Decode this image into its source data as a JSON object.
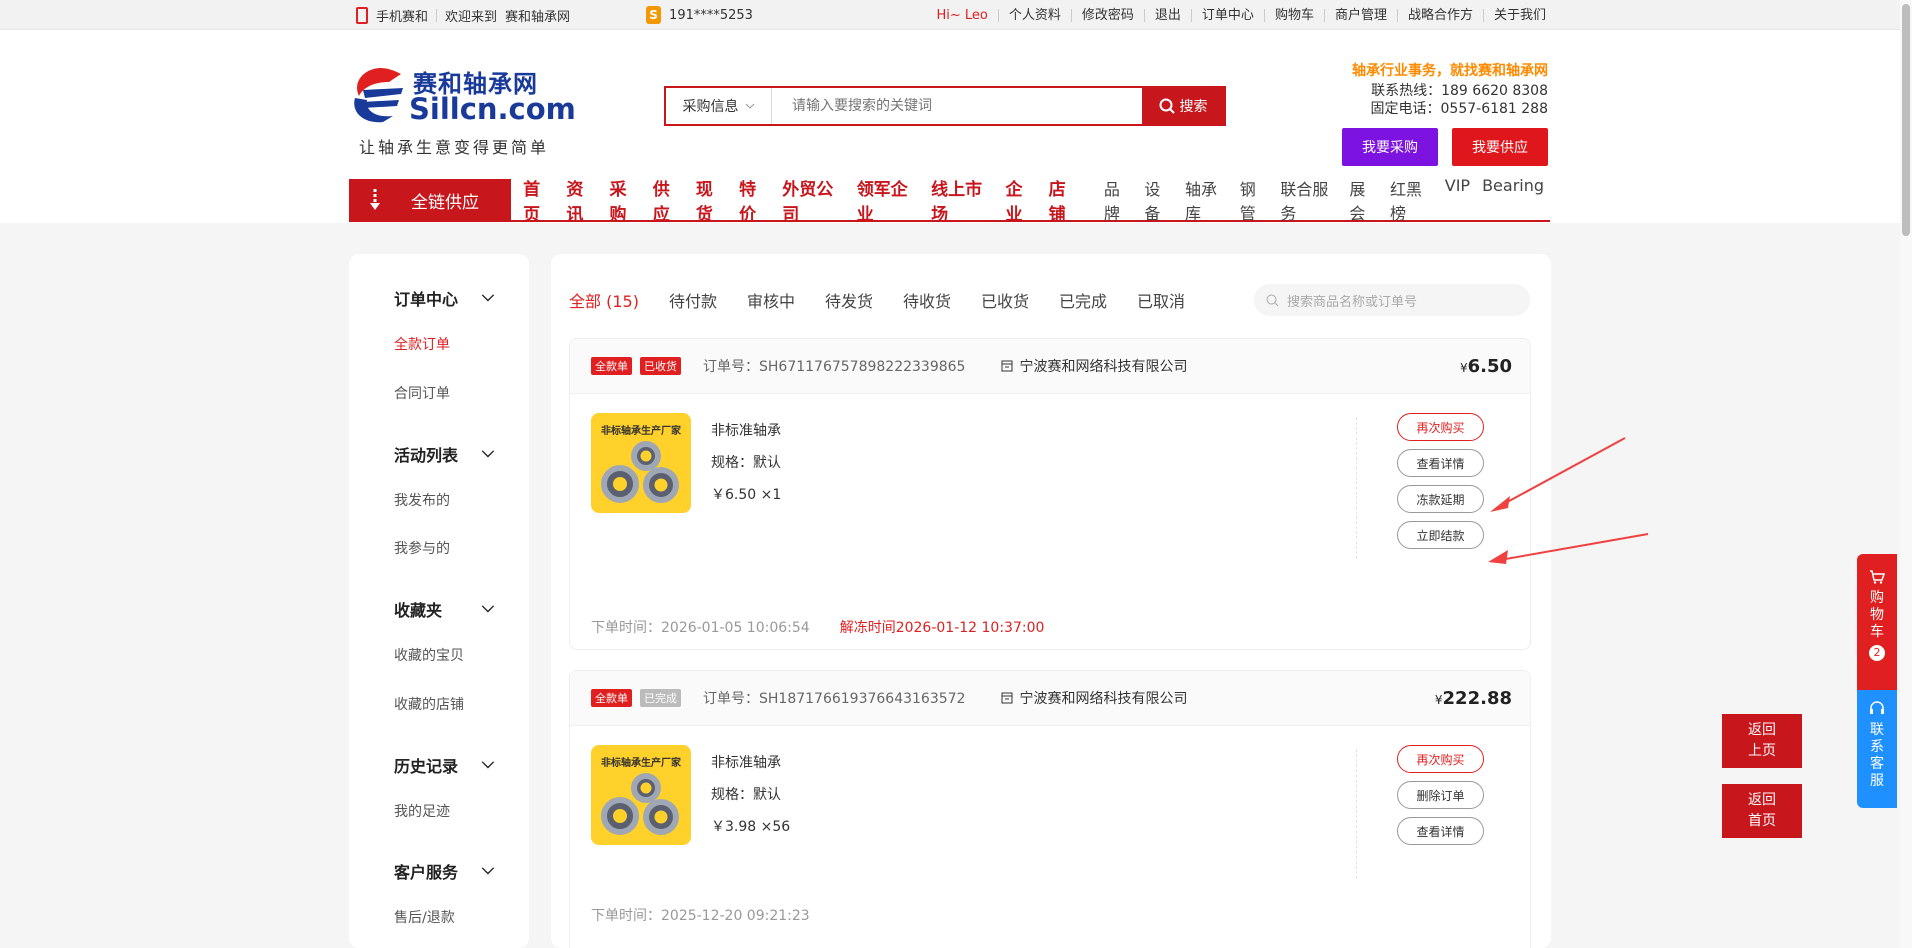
{
  "topbar": {
    "mobile": "手机赛和",
    "welcome": "欢迎来到",
    "site": "赛和轴承网",
    "phone": "191****5253",
    "links": [
      "Hi~ Leo",
      "个人资料",
      "修改密码",
      "退出",
      "订单中心",
      "购物车",
      "商户管理",
      "战略合作方",
      "关于我们"
    ]
  },
  "logo": {
    "cn": "赛和轴承网",
    "en": "Sillcn.com",
    "slogan": "让轴承生意变得更简单"
  },
  "search": {
    "category": "采购信息",
    "placeholder": "请输入要搜索的关键词",
    "button": "搜索"
  },
  "header_right": {
    "slogan": "轴承行业事务，就找赛和轴承网",
    "hotline": "联系热线：189 6620 8308",
    "fixed": "固定电话：0557-6181 288",
    "buy": "我要采购",
    "supply": "我要供应",
    "buy_color": "#7c13e0",
    "supply_color": "#e0161d"
  },
  "nav": {
    "all": "全链供应",
    "main": [
      "首页",
      "资讯",
      "采购",
      "供应",
      "现货",
      "特价",
      "外贸公司",
      "领军企业",
      "线上市场",
      "企业",
      "店铺"
    ],
    "sub": [
      "品牌",
      "设备",
      "轴承库",
      "钢管",
      "联合服务",
      "展会",
      "红黑榜",
      "VIP",
      "Bearing"
    ]
  },
  "sidebar": {
    "groups": [
      {
        "title": "订单中心",
        "items": [
          "全款订单",
          "合同订单"
        ]
      },
      {
        "title": "活动列表",
        "items": [
          "我发布的",
          "我参与的"
        ]
      },
      {
        "title": "收藏夹",
        "items": [
          "收藏的宝贝",
          "收藏的店铺"
        ]
      },
      {
        "title": "历史记录",
        "items": [
          "我的足迹"
        ]
      },
      {
        "title": "客户服务",
        "items": [
          "售后/退款"
        ]
      }
    ]
  },
  "tabs": [
    "全部 (15)",
    "待付款",
    "审核中",
    "待发货",
    "待收货",
    "已收货",
    "已完成",
    "已取消"
  ],
  "order_search_placeholder": "搜索商品名称或订单号",
  "orders": [
    {
      "tag1": "全款单",
      "tag2": "已收货",
      "order_no": "订单号：SH671176757898222339865",
      "shop": "宁波赛和网络科技有限公司",
      "currency": "¥",
      "price": "6.50",
      "img_text": "非标轴承生产厂家",
      "name": "非标准轴承",
      "spec": "规格：默认",
      "unit": "￥6.50 ×1",
      "buttons": [
        "再次购买",
        "查看详情",
        "冻款延期",
        "立即结款"
      ],
      "time": "下单时间：2026-01-05 10:06:54",
      "unfreeze": "解冻时间2026-01-12 10:37:00"
    },
    {
      "tag1": "全款单",
      "tag2": "已完成",
      "order_no": "订单号：SH187176619376643163572",
      "shop": "宁波赛和网络科技有限公司",
      "currency": "¥",
      "price": "222.88",
      "img_text": "非标轴承生产厂家",
      "name": "非标准轴承",
      "spec": "规格：默认",
      "unit": "￥3.98 ×56",
      "buttons": [
        "再次购买",
        "删除订单",
        "查看详情"
      ],
      "time": "下单时间：2025-12-20 09:21:23"
    }
  ],
  "float": {
    "cart": [
      "购",
      "物",
      "车"
    ],
    "cart_count": "2",
    "service": [
      "联",
      "系",
      "客",
      "服"
    ],
    "back_top": [
      "返回",
      "上页"
    ],
    "back_home": [
      "返回",
      "首页"
    ]
  }
}
